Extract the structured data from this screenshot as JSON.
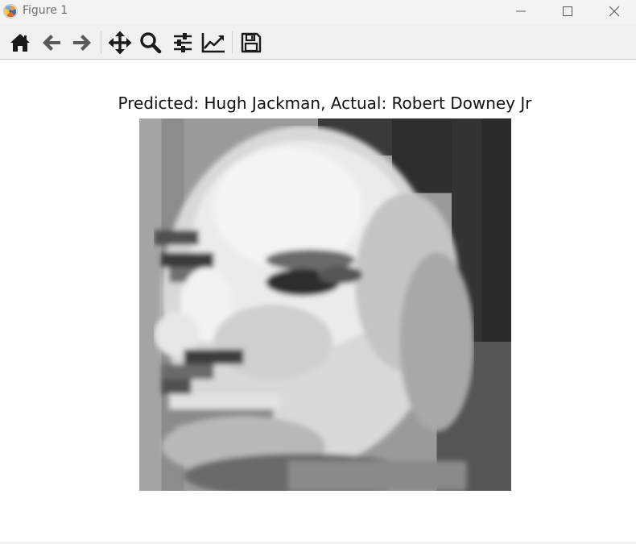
{
  "window": {
    "title": "Figure 1",
    "buttons": [
      "minimize",
      "maximize",
      "close"
    ]
  },
  "toolbar": {
    "tools": [
      {
        "name": "home",
        "icon": "home-icon"
      },
      {
        "name": "back",
        "icon": "arrow-left-icon"
      },
      {
        "name": "forward",
        "icon": "arrow-right-icon"
      },
      {
        "name": "pan",
        "icon": "move-icon"
      },
      {
        "name": "zoom",
        "icon": "magnifier-icon"
      },
      {
        "name": "configure subplots",
        "icon": "sliders-icon"
      },
      {
        "name": "edit axis",
        "icon": "line-chart-icon"
      },
      {
        "name": "save",
        "icon": "floppy-icon"
      }
    ]
  },
  "figure": {
    "title": "Predicted: Hugh Jackman, Actual: Robert Downey Jr",
    "image": {
      "description_colormap": "gray",
      "resolution": [
        50,
        50
      ]
    }
  },
  "colors": {
    "titlebar_bg": "#f3f3f3",
    "toolbar_bg": "#f0f0f0",
    "icon_color": "#1a1a1a",
    "canvas_bg": "#ffffff"
  }
}
